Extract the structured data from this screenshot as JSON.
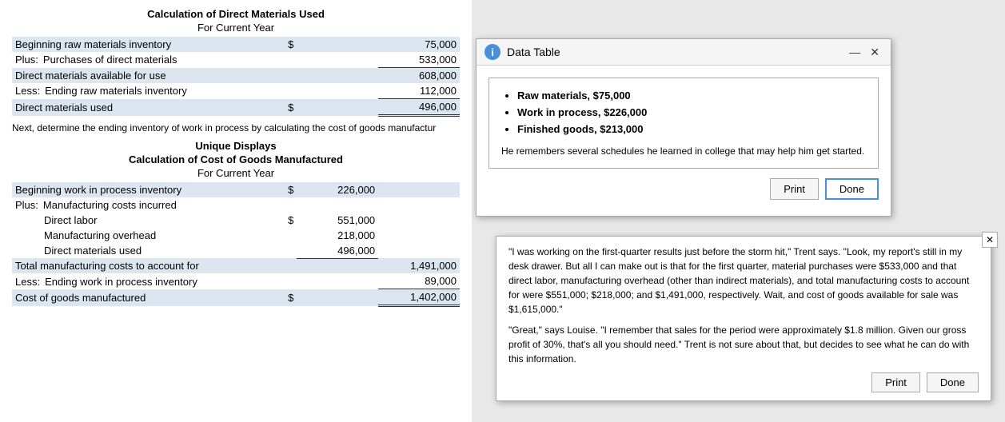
{
  "leftPanel": {
    "section1": {
      "title": "Calculation of Direct Materials Used",
      "subtitle": "For Current Year",
      "rows": [
        {
          "label": "Beginning raw materials inventory",
          "dollar": "$",
          "amount": "",
          "total": "75,000",
          "shaded": true,
          "indent": 0
        },
        {
          "prefix": "Plus:",
          "label": "Purchases of direct materials",
          "dollar": "",
          "amount": "",
          "total": "533,000",
          "shaded": false,
          "indent": 1
        },
        {
          "label": "Direct materials available for use",
          "dollar": "",
          "amount": "",
          "total": "608,000",
          "shaded": true,
          "indent": 0
        },
        {
          "prefix": "Less:",
          "label": "Ending raw materials inventory",
          "dollar": "",
          "amount": "",
          "total": "112,000",
          "shaded": false,
          "indent": 1
        },
        {
          "label": "Direct materials used",
          "dollar": "$",
          "amount": "",
          "total": "496,000",
          "shaded": true,
          "indent": 0,
          "doubleUnderline": true
        }
      ]
    },
    "narrative": "Next, determine the ending inventory of work in process by calculating the cost of goods manufactur",
    "section2": {
      "company": "Unique Displays",
      "title": "Calculation of Cost of Goods Manufactured",
      "subtitle": "For Current Year",
      "rows": [
        {
          "label": "Beginning work in process inventory",
          "dollar": "$",
          "amount": "226,000",
          "total": "",
          "shaded": true,
          "indent": 0
        },
        {
          "prefix": "Plus:",
          "label": "Manufacturing costs incurred",
          "dollar": "",
          "amount": "",
          "total": "",
          "shaded": false,
          "indent": 1
        },
        {
          "label": "Direct labor",
          "dollar": "$",
          "amount": "551,000",
          "total": "",
          "shaded": false,
          "indent": 2
        },
        {
          "label": "Manufacturing overhead",
          "dollar": "",
          "amount": "218,000",
          "total": "",
          "shaded": false,
          "indent": 2
        },
        {
          "label": "Direct materials used",
          "dollar": "",
          "amount": "496,000",
          "total": "",
          "shaded": false,
          "indent": 2
        },
        {
          "label": "Total manufacturing costs to account for",
          "dollar": "",
          "amount": "",
          "total": "1,491,000",
          "shaded": true,
          "indent": 0
        },
        {
          "prefix": "Less:",
          "label": "Ending work in process inventory",
          "dollar": "",
          "amount": "",
          "total": "89,000",
          "shaded": false,
          "indent": 1
        },
        {
          "label": "Cost of goods manufactured",
          "dollar": "$",
          "amount": "",
          "total": "1,402,000",
          "shaded": true,
          "indent": 0,
          "doubleUnderline": true
        }
      ]
    }
  },
  "dialog1": {
    "title": "Data Table",
    "infoIcon": "i",
    "bulletItems": [
      "Raw materials, $75,000",
      "Work in process, $226,000",
      "Finished goods, $213,000"
    ],
    "bodyText": "He remembers several schedules he learned in college that may help him get started.",
    "printLabel": "Print",
    "doneLabel": "Done"
  },
  "dialog2": {
    "paragraph1": "\"I was working on the first-quarter results just before the storm hit,\" Trent says. \"Look, my report's still in my desk drawer. But all I can make out is that for the first quarter, material purchases were $533,000 and that direct labor, manufacturing overhead (other than indirect materials), and total manufacturing costs to account for were $551,000; $218,000; and $1,491,000, respectively. Wait, and cost of goods available for sale was $1,615,000.\"",
    "paragraph2": "\"Great,\" says Louise. \"I remember that sales for the period were approximately $1.8 million. Given our gross profit of 30%, that's all you should need.\" Trent is not sure about that, but decides to see what he can do with this information.",
    "printLabel": "Print",
    "doneLabel": "Done"
  }
}
